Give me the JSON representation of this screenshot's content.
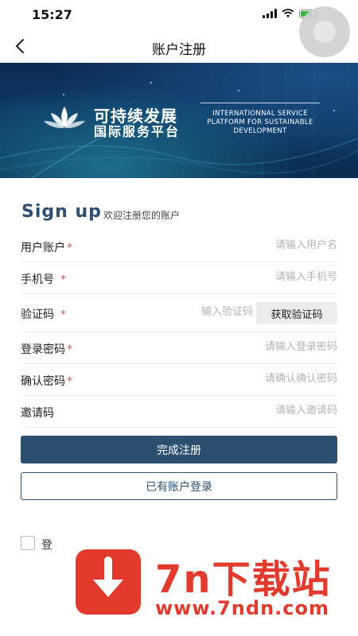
{
  "status_bar": {
    "time": "15:27"
  },
  "nav": {
    "title": "账户注册",
    "back_icon": "chevron-left-icon"
  },
  "banner": {
    "cn_line1": "可持续发展",
    "cn_line2": "国际服务平台",
    "en_line1": "INTERNATIONNAL SERVICE",
    "en_line2": "PLATFORM FOR SUSTAINABLE",
    "en_line3": "DEVELOPMENT"
  },
  "heading": {
    "title": "Sign up",
    "subtitle": "欢迎注册您的账户"
  },
  "form": {
    "fields": [
      {
        "label": "用户账户",
        "required": "*",
        "placeholder": "请输入用户名"
      },
      {
        "label": "手机号",
        "required": "*",
        "placeholder": "请输入手机号"
      },
      {
        "label": "验证码",
        "required": "*",
        "placeholder": "输入验证码",
        "button_label": "获取验证码"
      },
      {
        "label": "登录密码",
        "required": "*",
        "placeholder": "请输入登录密码"
      },
      {
        "label": "确认密码",
        "required": "*",
        "placeholder": "请确认确认密码"
      },
      {
        "label": "邀请码",
        "placeholder": "请输入邀请码"
      }
    ],
    "submit_label": "完成注册",
    "login_label": "已有账户登录",
    "agree_text": "登"
  },
  "watermark": {
    "title": "7n下载站",
    "url": "www.7ndn.com"
  },
  "colors": {
    "primary": "#2c4f6f",
    "required": "#d9534f",
    "watermark": "#e23b2d",
    "battery": "#3bb54a"
  }
}
